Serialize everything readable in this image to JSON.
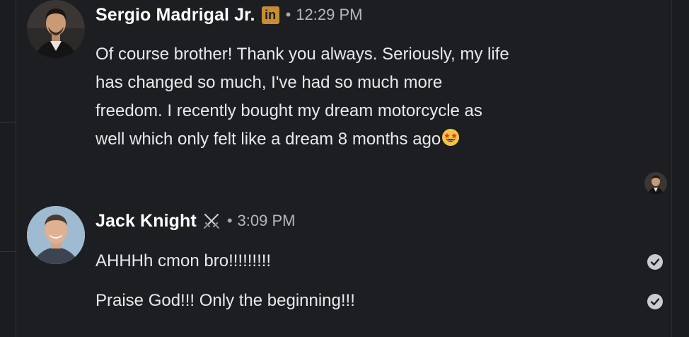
{
  "messages": [
    {
      "sender": "Sergio Madrigal Jr.",
      "badge": "in",
      "separator": "•",
      "time": "12:29 PM",
      "lines": [
        "Of course brother! Thank you always. Seriously, my life",
        "has changed so much, I've had so much more",
        "freedom. I recently bought my dream motorcycle as",
        "well which only felt like a dream 8 months ago"
      ],
      "emoji": "star-struck-emoji"
    },
    {
      "sender": "Jack Knight",
      "sender_icon": "crossed-swords-icon",
      "separator": "•",
      "time": "3:09 PM",
      "lines": [
        "AHHHh cmon bro!!!!!!!!!",
        "Praise God!!! Only the beginning!!!"
      ]
    }
  ],
  "colors": {
    "background": "#1d1e21",
    "linkedin_badge": "#c88c31",
    "text": "#e8e9ea",
    "muted": "#b5b7ba"
  },
  "icons": [
    "linkedin-badge-icon",
    "crossed-swords-icon",
    "star-struck-emoji",
    "read-check-icon"
  ]
}
